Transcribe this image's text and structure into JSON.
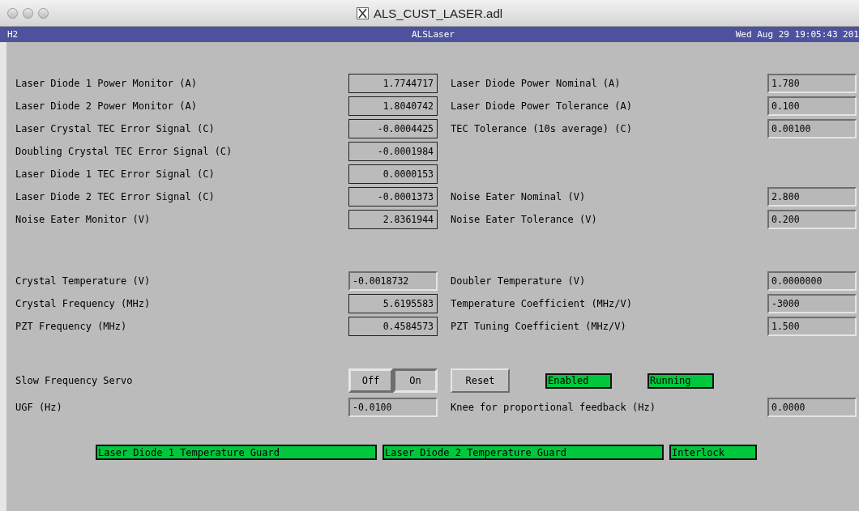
{
  "window": {
    "title": "ALS_CUST_LASER.adl"
  },
  "header": {
    "left": "H2",
    "center": "ALSLaser",
    "right": "Wed Aug 29 19:05:43 201"
  },
  "sections": [
    {
      "rows": [
        {
          "label": "Laser Diode 1 Power Monitor (A)",
          "value": "1.7744717",
          "kind": "monitor",
          "right": {
            "label": "Laser Diode Power Nominal (A)",
            "value": "1.780",
            "kind": "entry"
          }
        },
        {
          "label": "Laser Diode 2 Power Monitor (A)",
          "value": "1.8040742",
          "kind": "monitor",
          "right": {
            "label": "Laser Diode Power Tolerance (A)",
            "value": "0.100",
            "kind": "entry"
          }
        },
        {
          "label": "Laser Crystal TEC Error Signal (C)",
          "value": "-0.0004425",
          "kind": "monitor",
          "right": {
            "label": "TEC Tolerance (10s average) (C)",
            "value": "0.00100",
            "kind": "entry"
          }
        },
        {
          "label": "Doubling Crystal TEC Error Signal (C)",
          "value": "-0.0001984",
          "kind": "monitor"
        },
        {
          "label": "Laser Diode 1 TEC Error Signal (C)",
          "value": "0.0000153",
          "kind": "monitor"
        },
        {
          "label": "Laser Diode 2 TEC Error Signal (C)",
          "value": "-0.0001373",
          "kind": "monitor",
          "right": {
            "label": "Noise Eater Nominal (V)",
            "value": "2.800",
            "kind": "entry"
          }
        },
        {
          "label": "Noise Eater Monitor (V)",
          "value": "2.8361944",
          "kind": "monitor",
          "right": {
            "label": "Noise Eater Tolerance (V)",
            "value": "0.200",
            "kind": "entry"
          }
        }
      ]
    },
    {
      "rows": [
        {
          "label": "Crystal Temperature (V)",
          "value": "-0.0018732",
          "kind": "entry",
          "right": {
            "label": "Doubler Temperature (V)",
            "value": "0.0000000",
            "kind": "entry"
          }
        },
        {
          "label": "Crystal Frequency (MHz)",
          "value": "5.6195583",
          "kind": "monitor",
          "right": {
            "label": "Temperature Coefficient (MHz/V)",
            "value": "-3000",
            "kind": "entry"
          }
        },
        {
          "label": "PZT Frequency (MHz)",
          "value": "0.4584573",
          "kind": "monitor",
          "right": {
            "label": "PZT Tuning Coefficient (MHz/V)",
            "value": "1.500",
            "kind": "entry"
          }
        }
      ]
    }
  ],
  "servo": {
    "label": "Slow Frequency Servo",
    "options": [
      {
        "label": "Off",
        "selected": false
      },
      {
        "label": "On",
        "selected": true
      }
    ],
    "reset": "Reset",
    "indicators": [
      {
        "label": "Enabled",
        "color": "#00c83c"
      },
      {
        "label": "Running",
        "color": "#00c83c"
      }
    ]
  },
  "ugf": {
    "label": "UGF (Hz)",
    "value": "-0.0100",
    "kind": "entry",
    "right": {
      "label": "Knee for proportional feedback (Hz)",
      "value": "0.0000",
      "kind": "entry"
    }
  },
  "guards": [
    {
      "label": "Laser Diode 1 Temperature Guard",
      "color": "#00c83c"
    },
    {
      "label": "Laser Diode 2 Temperature Guard",
      "color": "#00c83c"
    },
    {
      "label": "Interlock",
      "color": "#00c83c"
    }
  ]
}
